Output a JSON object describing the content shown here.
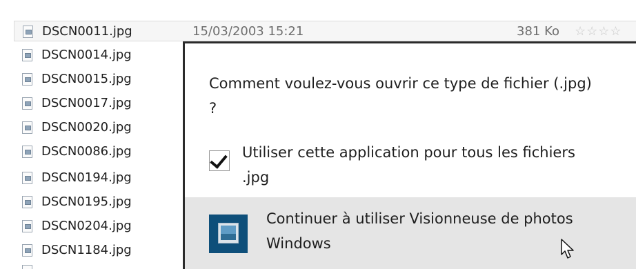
{
  "files": [
    {
      "name": "DSCN0011.jpg",
      "date": "15/03/2003 15:21",
      "size": "381 Ko",
      "rating": "☆☆☆☆",
      "selected": true
    },
    {
      "name": "DSCN0014.jpg"
    },
    {
      "name": "DSCN0015.jpg"
    },
    {
      "name": "DSCN0017.jpg"
    },
    {
      "name": "DSCN0020.jpg"
    },
    {
      "name": "DSCN0086.jpg"
    },
    {
      "name": "DSCN0194.jpg"
    },
    {
      "name": "DSCN0195.jpg"
    },
    {
      "name": "DSCN0204.jpg"
    },
    {
      "name": "DSCN1184.jpg"
    }
  ],
  "dialog": {
    "question": "Comment voulez-vous ouvrir ce type de fichier (.jpg) ?",
    "checkbox": {
      "label": "Utiliser cette application pour tous les fichiers .jpg",
      "checked": true
    },
    "option": {
      "label": "Continuer à utiliser Visionneuse de photos Windows",
      "icon": "photo-viewer-icon"
    }
  },
  "colors": {
    "selection_background": "#f6f6f6",
    "option_background": "#e5e5e5",
    "app_tile": "#0e4f7a",
    "dialog_border": "#2b2b2b"
  }
}
